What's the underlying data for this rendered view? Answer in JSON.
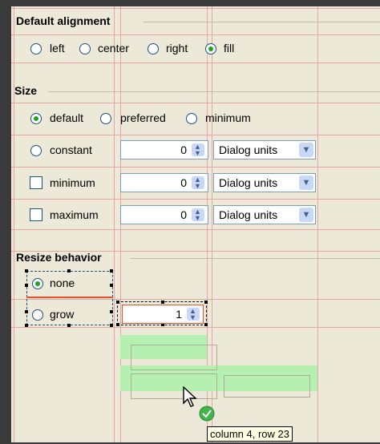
{
  "alignment": {
    "title": "Default alignment",
    "options": [
      "left",
      "center",
      "right",
      "fill"
    ],
    "selected": "fill"
  },
  "size": {
    "title": "Size",
    "options": [
      "default",
      "preferred",
      "minimum"
    ],
    "selected": "default",
    "constant_label": "constant",
    "minimum_label": "minimum",
    "maximum_label": "maximum",
    "constant_value": "0",
    "minimum_value": "0",
    "maximum_value": "0",
    "unit": "Dialog units"
  },
  "resize": {
    "title": "Resize behavior",
    "none_label": "none",
    "grow_label": "grow",
    "selected": "none",
    "grow_value": "1"
  },
  "tooltip": {
    "text": "column 4, row 23"
  },
  "icons": [
    "cursor-arrow-icon",
    "check-badge-icon",
    "dropdown-arrow-icon",
    "spinner-arrows-icon"
  ]
}
